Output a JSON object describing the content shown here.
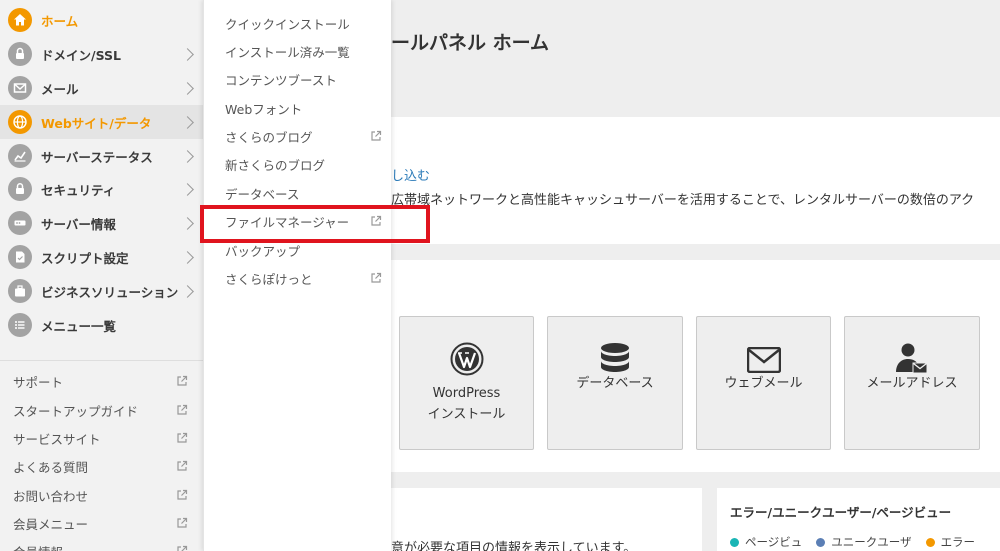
{
  "sidebar": {
    "nav": [
      {
        "label": "ホーム",
        "icon": "home-icon",
        "active": false,
        "home": true
      },
      {
        "label": "ドメイン/SSL",
        "icon": "domain-icon"
      },
      {
        "label": "メール",
        "icon": "mail-icon"
      },
      {
        "label": "Webサイト/データ",
        "icon": "globe-icon",
        "active": true
      },
      {
        "label": "サーバーステータス",
        "icon": "chart-icon"
      },
      {
        "label": "セキュリティ",
        "icon": "lock-icon"
      },
      {
        "label": "サーバー情報",
        "icon": "server-icon"
      },
      {
        "label": "スクリプト設定",
        "icon": "script-icon"
      },
      {
        "label": "ビジネスソリューション",
        "icon": "briefcase-icon"
      },
      {
        "label": "メニュー一覧",
        "icon": "list-icon"
      }
    ],
    "support": [
      {
        "label": "サポート"
      },
      {
        "label": "スタートアップガイド"
      },
      {
        "label": "サービスサイト"
      },
      {
        "label": "よくある質問"
      },
      {
        "label": "お問い合わせ"
      },
      {
        "label": "会員メニュー"
      },
      {
        "label": "会員情報"
      }
    ]
  },
  "flyout": {
    "items": [
      {
        "label": "クイックインストール",
        "external": false
      },
      {
        "label": "インストール済み一覧",
        "external": false
      },
      {
        "label": "コンテンツブースト",
        "external": false
      },
      {
        "label": "Webフォント",
        "external": false
      },
      {
        "label": "さくらのブログ",
        "external": true
      },
      {
        "label": "新さくらのブログ",
        "external": false
      },
      {
        "label": "データベース",
        "external": false
      },
      {
        "label": "ファイルマネージャー",
        "external": true
      },
      {
        "label": "バックアップ",
        "external": false
      },
      {
        "label": "さくらぽけっと",
        "external": true
      }
    ]
  },
  "main": {
    "title": "ールパネル ホーム",
    "banner_link": "し込む",
    "banner_text": "広帯域ネットワークと高性能キャッシュサーバーを活用することで、レンタルサーバーの数倍のアク",
    "tiles": [
      {
        "label": "WordPress\nインストール",
        "icon": "wordpress-icon"
      },
      {
        "label": "データベース",
        "icon": "database-icon"
      },
      {
        "label": "ウェブメール",
        "icon": "envelope-icon"
      },
      {
        "label": "メールアドレス",
        "icon": "user-mail-icon"
      }
    ],
    "notice_text": "意が必要な項目の情報を表示しています。",
    "chart_title": "エラー/ユニークユーザー/ページビュー",
    "legend": [
      {
        "label": "ページビュ",
        "color": "#1ab5b5"
      },
      {
        "label": "ユニークユーザ",
        "color": "#5b7fb5"
      },
      {
        "label": "エラー",
        "color": "#f39800"
      }
    ]
  },
  "colors": {
    "accent": "#f39800",
    "highlight": "#e0141e",
    "link": "#2a7ab8"
  }
}
